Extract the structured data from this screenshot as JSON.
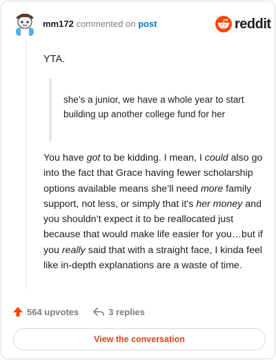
{
  "header": {
    "username": "mm172",
    "commented_text": "commented on",
    "post_link": "post",
    "brand": "reddit"
  },
  "comment": {
    "opening": "YTA.",
    "quote": "she’s a junior, we have a whole year to start building up another college fund for her",
    "body": [
      {
        "t": "You have "
      },
      {
        "t": "got",
        "em": true
      },
      {
        "t": " to be kidding. I mean, I "
      },
      {
        "t": "could",
        "em": true
      },
      {
        "t": " also go into the fact that Grace having fewer scholarship options available means she’ll need "
      },
      {
        "t": "more",
        "em": true
      },
      {
        "t": " family support, not less, or simply that it’s "
      },
      {
        "t": "her money",
        "em": true
      },
      {
        "t": " and you shouldn’t expect it to be reallocated just because that would make life easier for you…but if you "
      },
      {
        "t": "really",
        "em": true
      },
      {
        "t": " said that with a straight face, I kinda feel like in-depth explanations are a waste of time."
      }
    ]
  },
  "footer": {
    "upvotes": "564 upvotes",
    "replies": "3 replies",
    "view_button": "View the conversation"
  },
  "colors": {
    "upvote": "#ff4500",
    "link": "#0079d3",
    "cta": "#d9441b"
  }
}
